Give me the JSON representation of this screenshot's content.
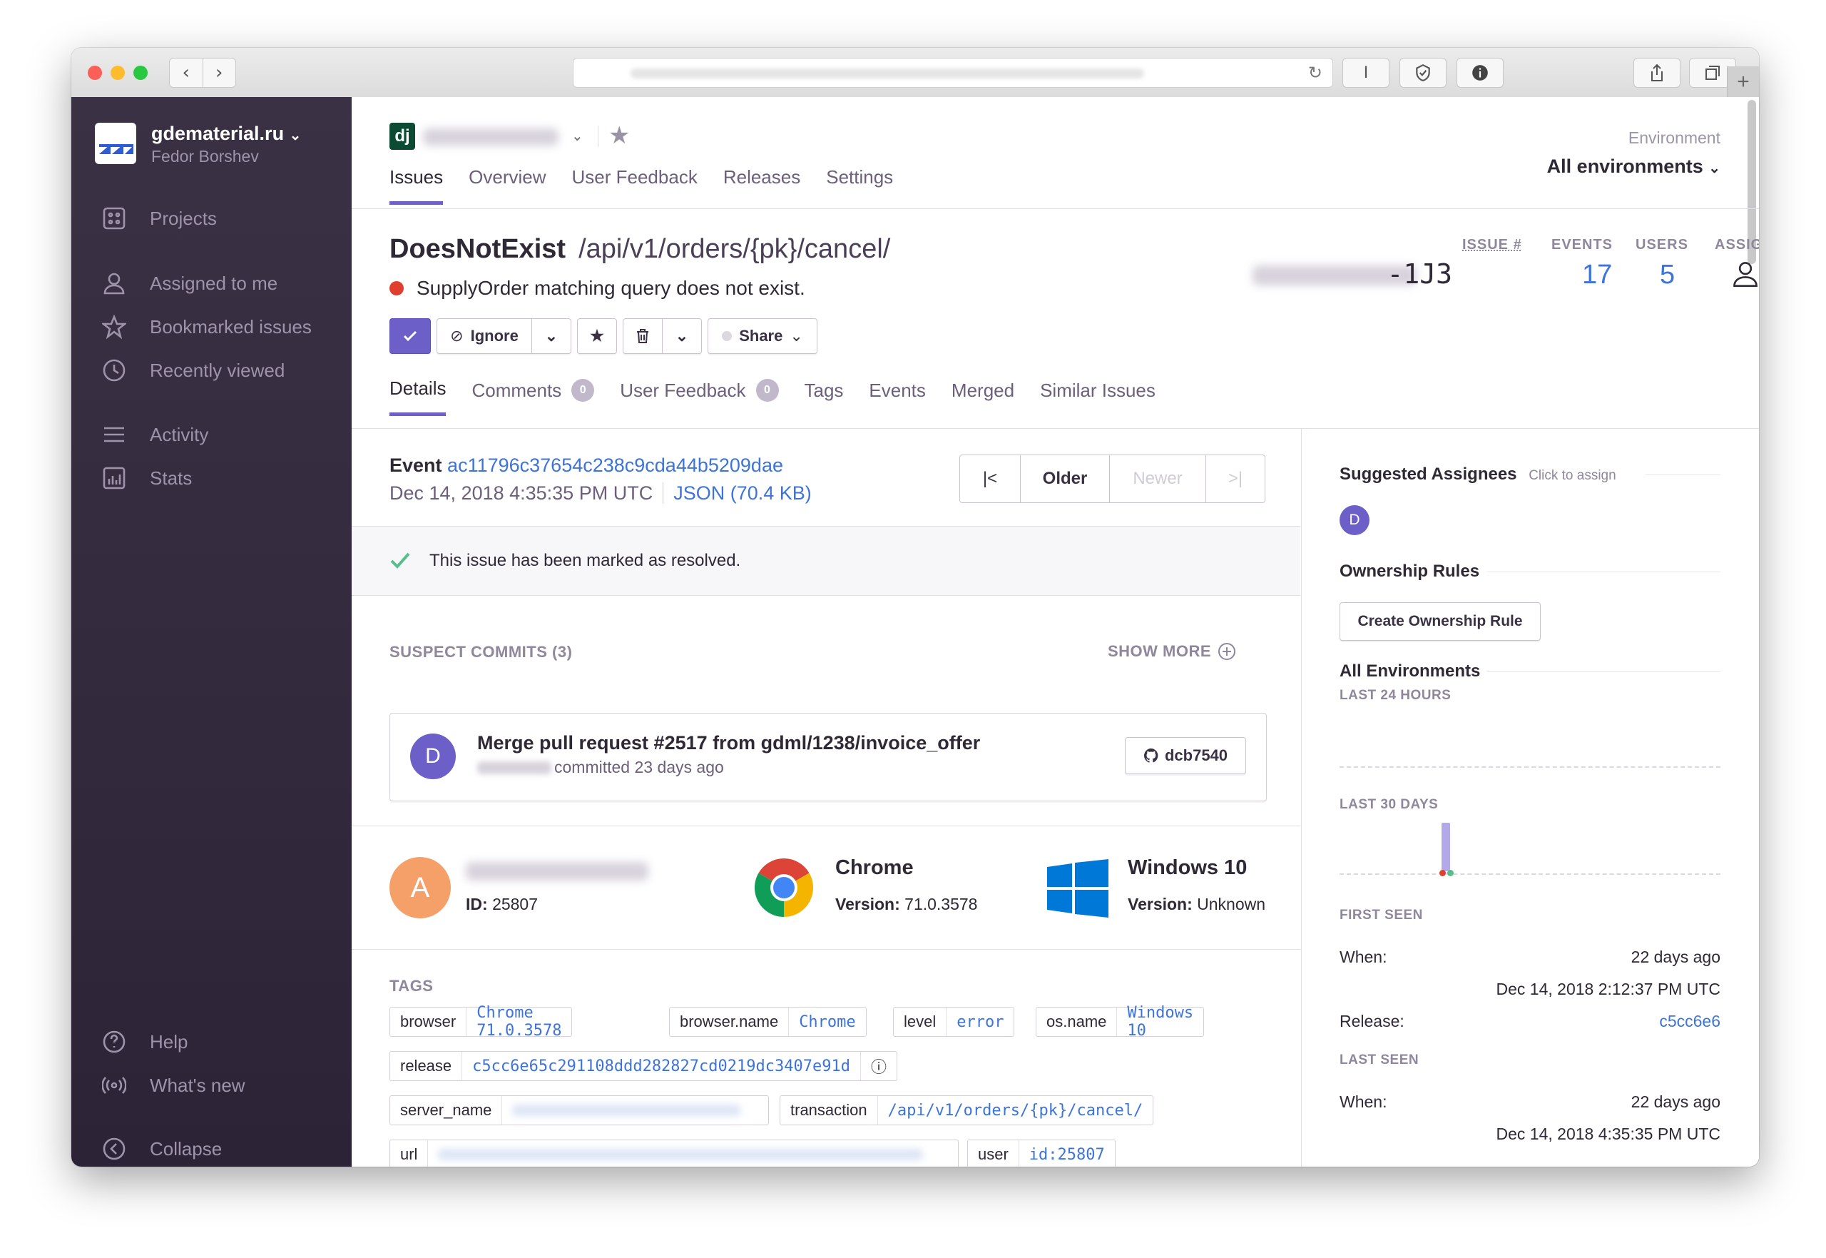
{
  "sidebar": {
    "org_name": "gdematerial.ru",
    "user_name": "Fedor Borshev",
    "items": [
      {
        "label": "Projects"
      },
      {
        "label": "Assigned to me"
      },
      {
        "label": "Bookmarked issues"
      },
      {
        "label": "Recently viewed"
      },
      {
        "label": "Activity"
      },
      {
        "label": "Stats"
      },
      {
        "label": "Help"
      },
      {
        "label": "What's new"
      },
      {
        "label": "Collapse"
      }
    ]
  },
  "header": {
    "project_logo": "dj",
    "tabs": [
      "Issues",
      "Overview",
      "User Feedback",
      "Releases",
      "Settings"
    ],
    "environment_label": "Environment",
    "environment_value": "All environments"
  },
  "issue": {
    "type": "DoesNotExist",
    "culprit": "/api/v1/orders/{pk}/cancel/",
    "message": "SupplyOrder matching query does not exist.",
    "short_id_suffix": "-1J3",
    "stats": {
      "issue_label": "ISSUE #",
      "events_label": "EVENTS",
      "events": "17",
      "users_label": "USERS",
      "users": "5",
      "assignee_label": "ASSIGNEE"
    },
    "actions": {
      "ignore": "Ignore",
      "share": "Share"
    },
    "tabs": [
      {
        "label": "Details"
      },
      {
        "label": "Comments",
        "badge": "0"
      },
      {
        "label": "User Feedback",
        "badge": "0"
      },
      {
        "label": "Tags"
      },
      {
        "label": "Events"
      },
      {
        "label": "Merged"
      },
      {
        "label": "Similar Issues"
      }
    ]
  },
  "event": {
    "label": "Event",
    "id": "ac11796c37654c238c9cda44b5209dae",
    "date": "Dec 14, 2018 4:35:35 PM UTC",
    "json_link": "JSON (70.4 KB)",
    "pager": {
      "older": "Older",
      "newer": "Newer"
    },
    "resolved_message": "This issue has been marked as resolved."
  },
  "commits": {
    "title": "SUSPECT COMMITS (3)",
    "show_more": "SHOW MORE",
    "avatar": "D",
    "message": "Merge pull request #2517 from gdml/1238/invoice_offer",
    "meta": "committed 23 days ago",
    "sha": "dcb7540"
  },
  "context": {
    "user": {
      "avatar": "A",
      "id_label": "ID:",
      "id": "25807"
    },
    "browser": {
      "name": "Chrome",
      "version_label": "Version:",
      "version": "71.0.3578"
    },
    "os": {
      "name": "Windows 10",
      "version_label": "Version:",
      "version": "Unknown"
    }
  },
  "tags": {
    "title": "TAGS",
    "items": [
      {
        "key": "browser",
        "value": "Chrome 71.0.3578"
      },
      {
        "key": "browser.name",
        "value": "Chrome"
      },
      {
        "key": "level",
        "value": "error"
      },
      {
        "key": "os.name",
        "value": "Windows 10"
      },
      {
        "key": "release",
        "value": "c5cc6e65c291108ddd282827cd0219dc3407e91d"
      },
      {
        "key": "server_name",
        "value": ""
      },
      {
        "key": "transaction",
        "value": "/api/v1/orders/{pk}/cancel/"
      },
      {
        "key": "url",
        "value": ""
      },
      {
        "key": "user",
        "value": "id:25807"
      }
    ]
  },
  "right": {
    "suggested_title": "Suggested Assignees",
    "suggested_hint": "Click to assign",
    "suggested_avatar": "D",
    "ownership_title": "Ownership Rules",
    "ownership_button": "Create Ownership Rule",
    "environments_title": "All Environments",
    "last24": "LAST 24 HOURS",
    "last30": "LAST 30 DAYS",
    "first_seen_label": "FIRST SEEN",
    "when_label": "When:",
    "first_seen_when": "22 days ago",
    "first_seen_date": "Dec 14, 2018 2:12:37 PM UTC",
    "release_label": "Release:",
    "release_value": "c5cc6e6",
    "last_seen_label": "LAST SEEN",
    "last_seen_when": "22 days ago",
    "last_seen_date": "Dec 14, 2018 4:35:35 PM UTC"
  },
  "colors": {
    "accent": "#6c5fc7",
    "link": "#3d74db",
    "sidebar": "#2f2936",
    "error": "#e03e2f",
    "success": "#57be8c"
  }
}
